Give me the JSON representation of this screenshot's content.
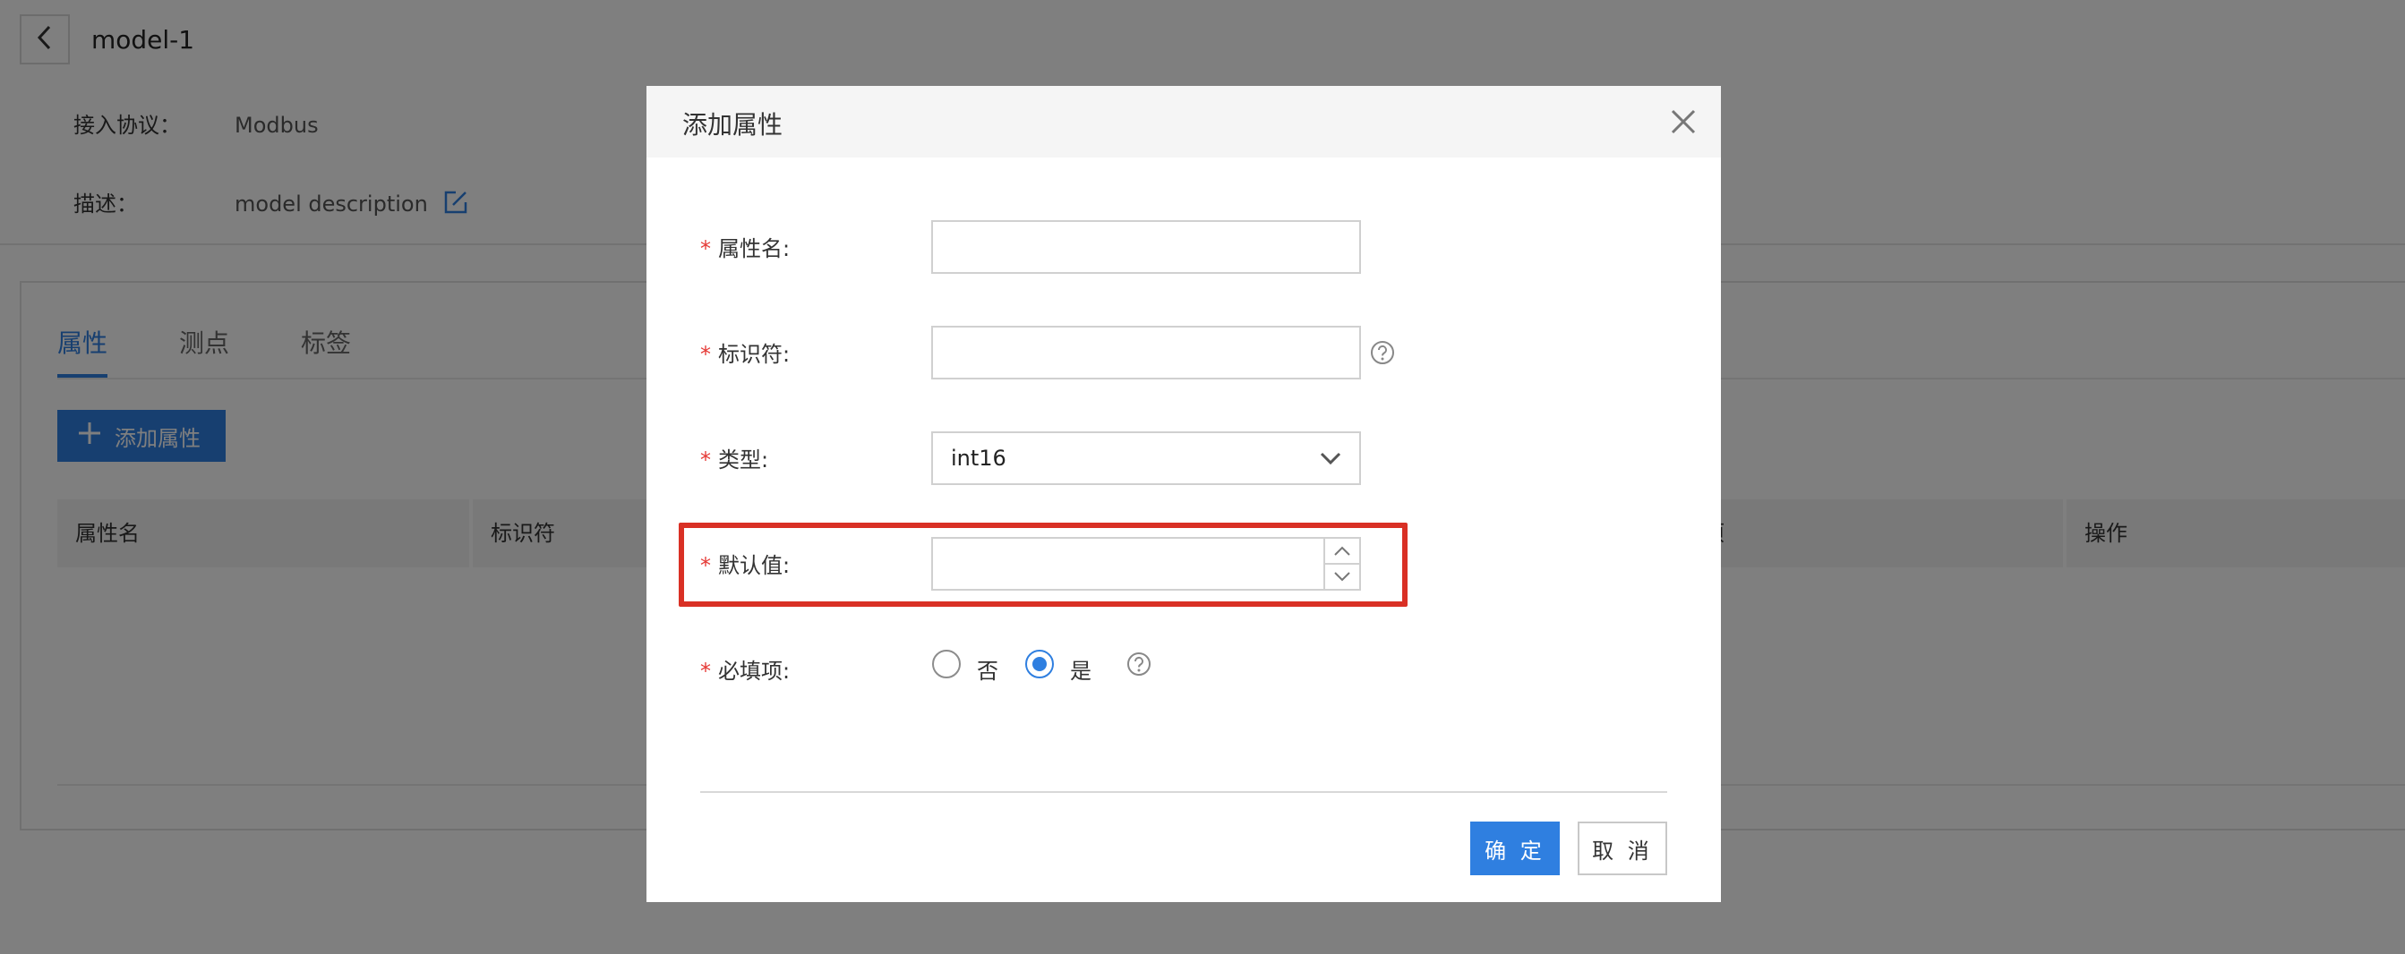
{
  "header": {
    "title": "model-1",
    "protocol_label": "接入协议：",
    "protocol_value": "Modbus",
    "description_label": "描述：",
    "description_value": "model description"
  },
  "tabs": [
    {
      "label": "属性",
      "active": true
    },
    {
      "label": "测点",
      "active": false
    },
    {
      "label": "标签",
      "active": false
    }
  ],
  "toolbar": {
    "add_label": "添加属性"
  },
  "table": {
    "headers": [
      "属性名",
      "标识符",
      "项",
      "操作"
    ]
  },
  "dialog": {
    "title": "添加属性",
    "fields": {
      "name_label": "属性名:",
      "identifier_label": "标识符:",
      "type_label": "类型:",
      "type_value": "int16",
      "default_label": "默认值:",
      "required_label": "必填项:",
      "required_options": [
        "否",
        "是"
      ],
      "required_selected": "是"
    },
    "ok_label": "确 定",
    "cancel_label": "取 消"
  },
  "colors": {
    "accent": "#2f7fe0",
    "highlight": "#d93025",
    "required": "#e53935"
  },
  "icons": [
    "back-arrow-icon",
    "edit-icon",
    "plus-icon",
    "close-icon",
    "help-icon",
    "chevron-down-icon",
    "chevron-up-icon"
  ]
}
